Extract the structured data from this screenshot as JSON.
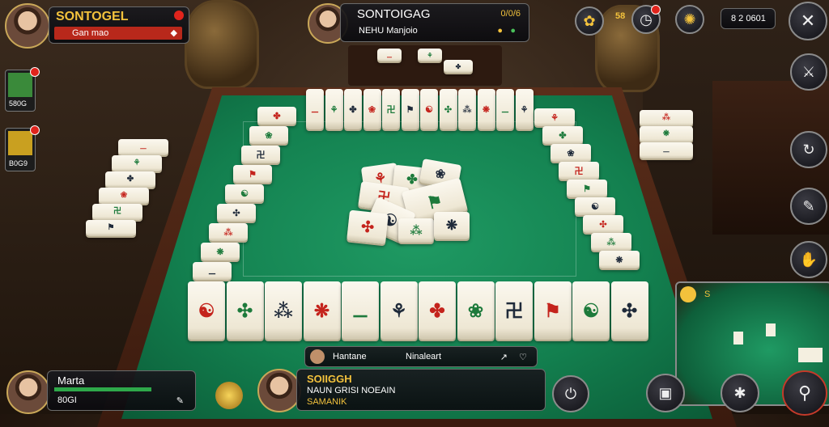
{
  "player_top_left": {
    "name": "SONTOGEL",
    "sub": "Gan mao",
    "diamond_icon": "diamond-icon",
    "status_icon": "record-icon"
  },
  "player_top_center": {
    "name": "SONTOIGAG",
    "stat": "0/0/6",
    "sub": "NEHU Manjoio",
    "status_icons": [
      "info-icon",
      "chip-icon"
    ]
  },
  "top_right": {
    "balance": "8 2 0601",
    "counter": "58",
    "icons": [
      "flower-icon",
      "timer-icon",
      "settings-icon",
      "tools-icon"
    ]
  },
  "left_rail": [
    {
      "label": "580G",
      "icon": "character-icon"
    },
    {
      "label": "B0G9",
      "icon": "character-icon"
    }
  ],
  "right_rail": [
    "feather-icon",
    "swap-icon",
    "edit-icon",
    "hands-icon",
    "sound-icon"
  ],
  "bottom_left_player": {
    "name": "Marta",
    "score": "80GI"
  },
  "bottom_center_player": {
    "name": "SOIIGGH",
    "line1": "NAUN GRISI NOEAIN",
    "line2": "SAMANIK"
  },
  "turn_bar": {
    "left": "Hantane",
    "right": "Ninaleart"
  },
  "bottom_buttons": [
    "power-icon",
    "cup-icon",
    "gear-icon",
    "sword-icon"
  ],
  "minimap": {
    "label": "S",
    "icon": "minimap-icon"
  },
  "colors": {
    "felt": "#13804f",
    "wood": "#5a2e1a",
    "accent_gold": "#f3c23c",
    "alert_red": "#e0241c"
  }
}
